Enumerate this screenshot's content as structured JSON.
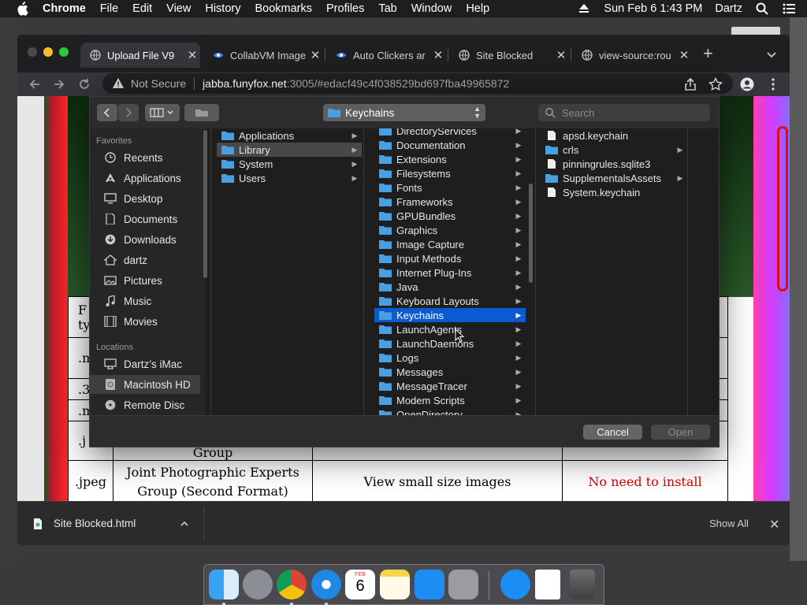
{
  "menubar": {
    "app_name": "Chrome",
    "menus": [
      "File",
      "Edit",
      "View",
      "History",
      "Bookmarks",
      "Profiles",
      "Tab",
      "Window",
      "Help"
    ],
    "clock": "Sun Feb 6  1:43 PM",
    "user": "Dartz"
  },
  "tabs": [
    {
      "title": "Upload File V9",
      "active": true
    },
    {
      "title": "CollabVM Image",
      "active": false
    },
    {
      "title": "Auto Clickers ar",
      "active": false
    },
    {
      "title": "Site Blocked",
      "active": false
    },
    {
      "title": "view-source:rou",
      "active": false
    }
  ],
  "omnibox": {
    "security": "Not Secure",
    "host": "jabba.funyfox.net",
    "rest": ":3005/#edacf49c4f038529bd697fba49965872"
  },
  "page": {
    "rows": [
      {
        "c1": "F",
        "c1b": "ty",
        "c2": "",
        "c3": "",
        "c4": ""
      },
      {
        "c1": ".m",
        "c2": "",
        "c3": "",
        "c4": ""
      },
      {
        "c1": ".3",
        "c2": "",
        "c3": "",
        "c4": ""
      },
      {
        "c1": ".m",
        "c2": "",
        "c3": "",
        "c4": ""
      },
      {
        "c1": ".j",
        "c2": "Group",
        "c3": "",
        "c4": ""
      },
      {
        "c1": ".jpeg",
        "c2": "Joint Photographic Experts Group (Second Format)",
        "c3": "View small size images",
        "c4": "No need to install"
      }
    ]
  },
  "downloads": {
    "file": "Site Blocked.html",
    "show_all": "Show All"
  },
  "dialog": {
    "path": "Keychains",
    "search_placeholder": "Search",
    "sidebar": {
      "favorites_header": "Favorites",
      "favorites": [
        "Recents",
        "Applications",
        "Desktop",
        "Documents",
        "Downloads",
        "dartz",
        "Pictures",
        "Music",
        "Movies"
      ],
      "locations_header": "Locations",
      "locations": [
        "Dartz’s iMac",
        "Macintosh HD",
        "Remote Disc"
      ],
      "selected": "Macintosh HD"
    },
    "col1": [
      "Applications",
      "Library",
      "System",
      "Users"
    ],
    "col1_selected": "Library",
    "col2": [
      "DirectoryServices",
      "Documentation",
      "Extensions",
      "Filesystems",
      "Fonts",
      "Frameworks",
      "GPUBundles",
      "Graphics",
      "Image Capture",
      "Input Methods",
      "Internet Plug-Ins",
      "Java",
      "Keyboard Layouts",
      "Keychains",
      "LaunchAgents",
      "LaunchDaemons",
      "Logs",
      "Messages",
      "MessageTracer",
      "Modem Scripts",
      "OpenDirectory"
    ],
    "col2_selected": "Keychains",
    "col3": [
      {
        "name": "apsd.keychain",
        "kind": "file"
      },
      {
        "name": "crls",
        "kind": "folder"
      },
      {
        "name": "pinningrules.sqlite3",
        "kind": "file"
      },
      {
        "name": "SupplementalsAssets",
        "kind": "folder"
      },
      {
        "name": "System.keychain",
        "kind": "file"
      }
    ],
    "cancel_label": "Cancel",
    "open_label": "Open"
  },
  "dock": {
    "apps": [
      "finder-icon",
      "launchpad-icon",
      "chrome-icon",
      "safari-icon",
      "calendar-icon",
      "notes-icon",
      "app-store-icon",
      "system-preferences-icon",
      "app-store-alt-icon",
      "html-file-icon",
      "trash-icon"
    ],
    "calendar": {
      "month": "FEB",
      "day": "6"
    }
  },
  "colors": {
    "selection": "#0a5ad0",
    "folder": "#4a9fe0",
    "red_text": "#e00000"
  }
}
